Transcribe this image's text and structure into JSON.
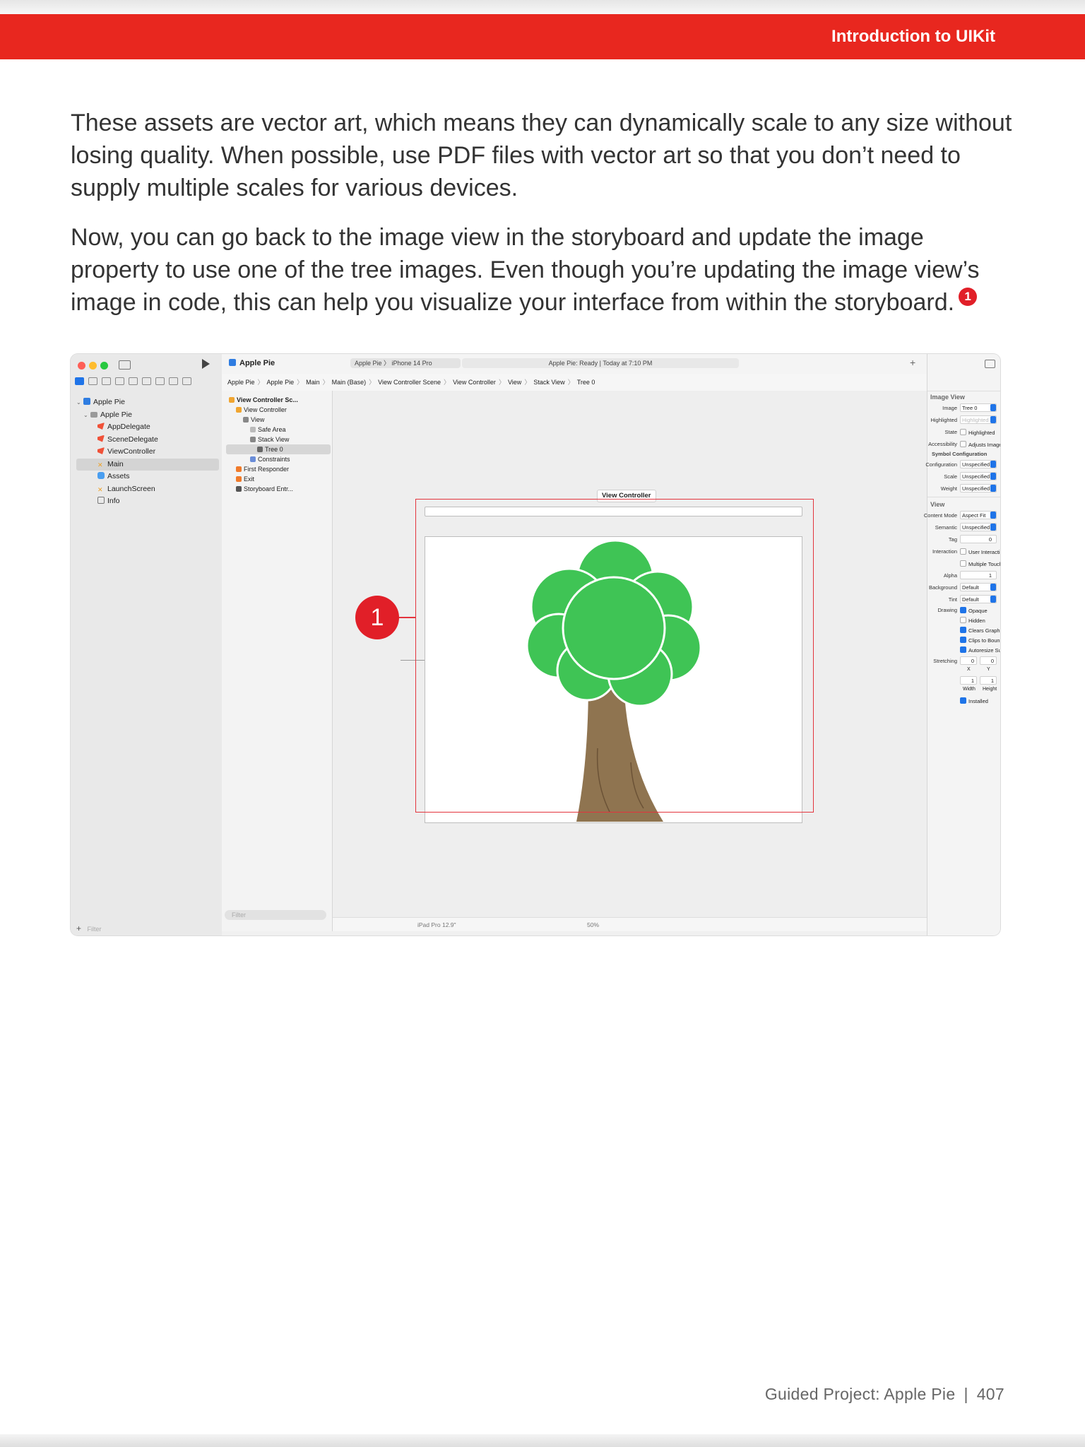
{
  "header": {
    "title": "Introduction to UIKit"
  },
  "paragraphs": [
    "These assets are vector art, which means they can dynamically scale to any size without losing quality. When possible, use PDF files with vector art so that you don’t need to supply multiple scales for various devices.",
    "Now, you can go back to the image view in the storyboard and update the image property to use one of the tree images. Even though you’re updating the image view’s image in code, this can help you visualize your interface from within the storyboard."
  ],
  "callout_number": "1",
  "xcode": {
    "app_name": "Apple Pie",
    "scheme": "Apple Pie 〉  iPhone 14 Pro",
    "status": "Apple Pie: Ready | Today at 7:10 PM",
    "add_label": "+",
    "jumpbar": [
      "Apple Pie",
      "Apple Pie",
      "Main",
      "Main (Base)",
      "View Controller Scene",
      "View Controller",
      "View",
      "Stack View",
      "Tree 0"
    ],
    "navigator": [
      {
        "label": "Apple Pie",
        "icon": "project-icon",
        "indent": 0,
        "chevron": "⌵"
      },
      {
        "label": "Apple Pie",
        "icon": "folder-icon",
        "indent": 1,
        "chevron": "⌵"
      },
      {
        "label": "AppDelegate",
        "icon": "swift-file-icon",
        "indent": 2,
        "chevron": ""
      },
      {
        "label": "SceneDelegate",
        "icon": "swift-file-icon",
        "indent": 2,
        "chevron": ""
      },
      {
        "label": "ViewController",
        "icon": "swift-file-icon",
        "indent": 2,
        "chevron": ""
      },
      {
        "label": "Main",
        "icon": "storyboard-icon",
        "indent": 2,
        "chevron": "",
        "selected": true
      },
      {
        "label": "Assets",
        "icon": "assets-icon",
        "indent": 2,
        "chevron": ""
      },
      {
        "label": "LaunchScreen",
        "icon": "storyboard-icon",
        "indent": 2,
        "chevron": ""
      },
      {
        "label": "Info",
        "icon": "plist-icon",
        "indent": 2,
        "chevron": ""
      }
    ],
    "nav_filter": "Filter",
    "outline": [
      {
        "label": "View Controller Sc...",
        "indent": 0,
        "color": "#f0a530",
        "bold": true
      },
      {
        "label": "View Controller",
        "indent": 1,
        "color": "#f0a530"
      },
      {
        "label": "View",
        "indent": 2,
        "color": "#888888"
      },
      {
        "label": "Safe Area",
        "indent": 3,
        "color": "#bbbbbb"
      },
      {
        "label": "Stack View",
        "indent": 3,
        "color": "#888888"
      },
      {
        "label": "Tree 0",
        "indent": 4,
        "color": "#666666",
        "selected": true
      },
      {
        "label": "Constraints",
        "indent": 3,
        "color": "#6a8dd8"
      },
      {
        "label": "First Responder",
        "indent": 1,
        "color": "#f07a2a"
      },
      {
        "label": "Exit",
        "indent": 1,
        "color": "#f07a2a"
      },
      {
        "label": "Storyboard Entr...",
        "indent": 1,
        "color": "#555555"
      }
    ],
    "outline_filter": "Filter",
    "scene_label": "View Controller",
    "device": "iPad Pro 12.9\"",
    "zoom": "50%",
    "inspector": {
      "title": "Image View",
      "image_label": "Image",
      "image_value": "Tree 0",
      "highlighted_label": "Highlighted",
      "highlighted_placeholder": "Highlighted Image",
      "state_label": "State",
      "state_check": "Highlighted",
      "accessibility_label": "Accessibility",
      "accessibility_check": "Adjusts Image Size",
      "symbol_config": "Symbol Configuration",
      "configuration_label": "Configuration",
      "configuration_value": "Unspecified",
      "scale_label": "Scale",
      "scale_value": "Unspecified",
      "weight_label": "Weight",
      "weight_value": "Unspecified",
      "view_title": "View",
      "content_mode_label": "Content Mode",
      "content_mode_value": "Aspect Fit",
      "semantic_label": "Semantic",
      "semantic_value": "Unspecified",
      "tag_label": "Tag",
      "tag_value": "0",
      "interaction_label": "Interaction",
      "interaction_check1": "User Interaction Enabled",
      "interaction_check2": "Multiple Touch",
      "alpha_label": "Alpha",
      "alpha_value": "1",
      "background_label": "Background",
      "background_value": "Default",
      "tint_label": "Tint",
      "tint_value": "Default",
      "drawing_label": "Drawing",
      "drawing_checks": [
        {
          "label": "Opaque",
          "on": true
        },
        {
          "label": "Hidden",
          "on": false
        },
        {
          "label": "Clears Graphics Context",
          "on": true
        },
        {
          "label": "Clips to Bounds",
          "on": true
        },
        {
          "label": "Autoresize Subviews",
          "on": true
        }
      ],
      "stretching_label": "Stretching",
      "stretch_x": "0",
      "stretch_y": "0",
      "stretch_x_caption": "X",
      "stretch_y_caption": "Y",
      "stretch_w": "1",
      "stretch_h": "1",
      "width_caption": "Width",
      "height_caption": "Height",
      "installed_label": "Installed"
    }
  },
  "footer": {
    "title": "Guided Project: Apple Pie",
    "separator": "|",
    "page": "407"
  },
  "colors": {
    "header_red": "#e8271f",
    "callout_red": "#e11f28",
    "tree_green": "#3cc452",
    "trunk_brown": "#8a6c48"
  }
}
